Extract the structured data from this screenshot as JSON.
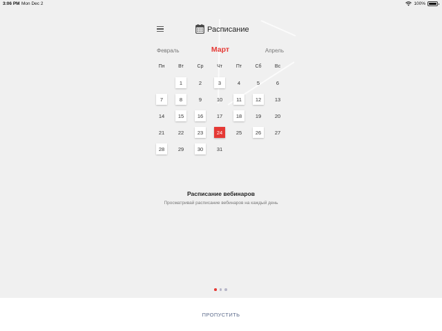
{
  "status_bar": {
    "time": "3:06 PM",
    "date": "Mon Dec 2",
    "battery_text": "100%",
    "battery_level": 1.0
  },
  "header": {
    "title": "Расписание",
    "menu_icon": "hamburger-menu-icon",
    "calendar_icon": "calendar-icon"
  },
  "calendar": {
    "prev_month": "Февраль",
    "current_month": "Март",
    "next_month": "Апрель",
    "weekdays": [
      "Пн",
      "Вт",
      "Ср",
      "Чт",
      "Пт",
      "Сб",
      "Вс"
    ],
    "first_weekday_offset": 1,
    "days": [
      {
        "label": "1",
        "style": "boxed"
      },
      {
        "label": "2",
        "style": "plain"
      },
      {
        "label": "3",
        "style": "boxed"
      },
      {
        "label": "4",
        "style": "plain"
      },
      {
        "label": "5",
        "style": "plain"
      },
      {
        "label": "6",
        "style": "plain"
      },
      {
        "label": "7",
        "style": "boxed"
      },
      {
        "label": "8",
        "style": "boxed"
      },
      {
        "label": "9",
        "style": "plain"
      },
      {
        "label": "10",
        "style": "plain"
      },
      {
        "label": "11",
        "style": "boxed"
      },
      {
        "label": "12",
        "style": "boxed"
      },
      {
        "label": "13",
        "style": "plain"
      },
      {
        "label": "14",
        "style": "plain"
      },
      {
        "label": "15",
        "style": "boxed"
      },
      {
        "label": "16",
        "style": "boxed"
      },
      {
        "label": "17",
        "style": "plain"
      },
      {
        "label": "18",
        "style": "boxed"
      },
      {
        "label": "19",
        "style": "plain"
      },
      {
        "label": "20",
        "style": "plain"
      },
      {
        "label": "21",
        "style": "plain"
      },
      {
        "label": "22",
        "style": "plain"
      },
      {
        "label": "23",
        "style": "boxed"
      },
      {
        "label": "24",
        "style": "today"
      },
      {
        "label": "25",
        "style": "plain"
      },
      {
        "label": "26",
        "style": "boxed"
      },
      {
        "label": "27",
        "style": "plain"
      },
      {
        "label": "28",
        "style": "boxed"
      },
      {
        "label": "29",
        "style": "plain"
      },
      {
        "label": "30",
        "style": "boxed"
      },
      {
        "label": "31",
        "style": "plain"
      }
    ]
  },
  "info": {
    "title": "Расписание вебинаров",
    "subtitle": "Просматривай расписание вебинаров на каждый день"
  },
  "pager": {
    "count": 3,
    "active_index": 0
  },
  "skip_button": {
    "label": "ПРОПУСТИТЬ"
  },
  "colors": {
    "accent": "#e53935",
    "background": "#f0f0f0",
    "skip_text": "#5b6a8a",
    "dot_inactive": "#b6b6c8"
  }
}
